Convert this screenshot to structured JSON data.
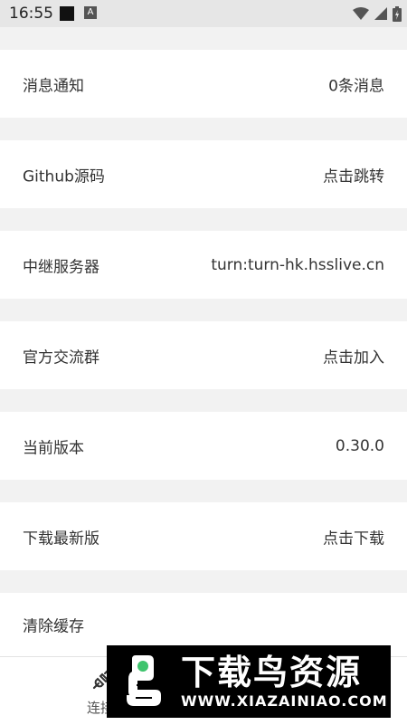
{
  "status_bar": {
    "time": "16:55",
    "notification_icon_a": "A"
  },
  "settings": [
    {
      "label": "消息通知",
      "value": "0条消息"
    },
    {
      "label": "Github源码",
      "value": "点击跳转"
    },
    {
      "label": "中继服务器",
      "value": "turn:turn-hk.hsslive.cn"
    },
    {
      "label": "官方交流群",
      "value": "点击加入"
    },
    {
      "label": "当前版本",
      "value": "0.30.0"
    },
    {
      "label": "下载最新版",
      "value": "点击下载"
    },
    {
      "label": "清除缓存",
      "value": ""
    }
  ],
  "bottom_nav": {
    "label": "连接",
    "icon": "plug-icon"
  },
  "watermark": {
    "cn": "下载鸟资源",
    "url": "WWW.XIAZAINIAO.COM",
    "accent": "#3ec46d"
  }
}
